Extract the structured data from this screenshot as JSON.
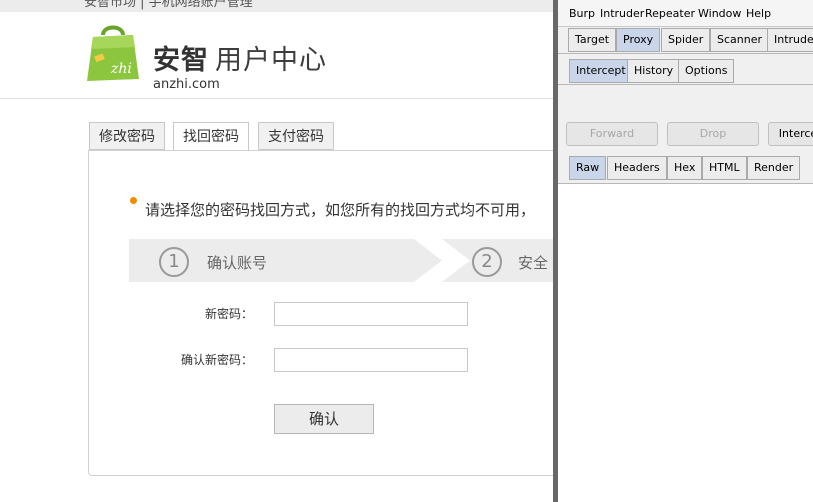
{
  "site": {
    "top_cut_text": "安智市场 | 手机网络账户管理",
    "brand_name": "安智",
    "brand_sub": "用户中心",
    "domain": "anzhi.com",
    "logo_text": "zhi",
    "tabs": [
      "修改密码",
      "找回密码",
      "支付密码"
    ],
    "active_tab": "找回密码",
    "notice": "请选择您的密码找回方式，如您所有的找回方式均不可用，",
    "steps": [
      {
        "num": "1",
        "label": "确认账号"
      },
      {
        "num": "2",
        "label": "安全"
      }
    ],
    "fields": [
      {
        "label": "新密码：",
        "value": ""
      },
      {
        "label": "确认新密码：",
        "value": ""
      }
    ],
    "confirm_label": "确认",
    "colors": {
      "accent_dot": "#f08c00",
      "logo_green": "#8cc63f"
    }
  },
  "burp": {
    "menu": [
      "Burp",
      "Intruder",
      "Repeater",
      "Window",
      "Help"
    ],
    "main_tabs": [
      "Target",
      "Proxy",
      "Spider",
      "Scanner",
      "Intruder"
    ],
    "active_main_tab": "Proxy",
    "sub_tabs": [
      "Intercept",
      "History",
      "Options"
    ],
    "active_sub_tab": "Intercept",
    "actions": [
      "Forward",
      "Drop",
      "Interce"
    ],
    "view_tabs": [
      "Raw",
      "Headers",
      "Hex",
      "HTML",
      "Render"
    ],
    "active_view_tab": "Raw"
  }
}
